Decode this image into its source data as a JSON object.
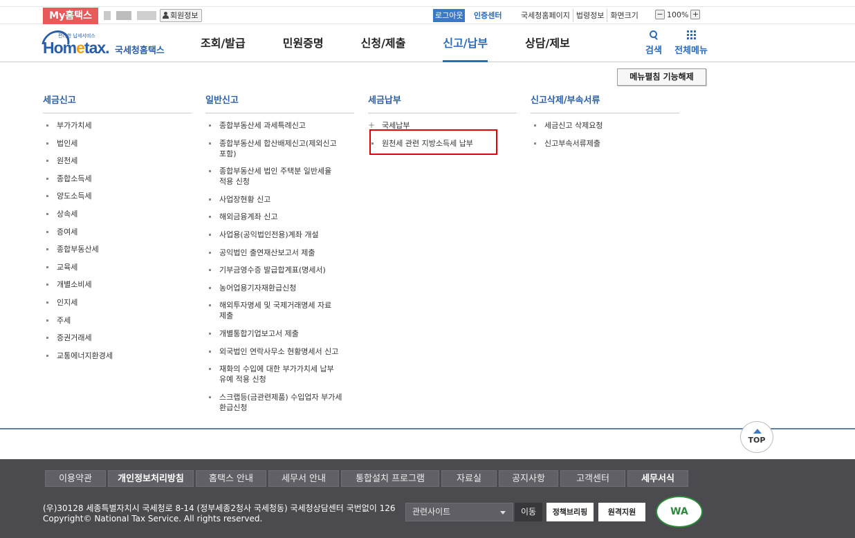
{
  "topbar": {
    "my_label": "My홈택스",
    "member_info": "회원정보",
    "logout": "로그아웃",
    "cert_center": "인증센터",
    "links": [
      "국세청홈페이지",
      "법령정보",
      "화면크기"
    ],
    "zoom_minus": "−",
    "zoom_value": "100%",
    "zoom_plus": "+"
  },
  "logo": {
    "main_a": "Hom",
    "main_e": "e",
    "main_b": "tax.",
    "sub": "국세청홈택스",
    "tiny": "편리한 납세서비스"
  },
  "gnb": [
    {
      "label": "조회/발급"
    },
    {
      "label": "민원증명"
    },
    {
      "label": "신청/제출"
    },
    {
      "label": "신고/납부",
      "active": true
    },
    {
      "label": "상담/제보"
    }
  ],
  "header_tools": {
    "search": "검색",
    "allmenu": "전체메뉴"
  },
  "menufix": "메뉴펼침 기능해제",
  "columns": [
    {
      "title": "세금신고",
      "items": [
        "부가가치세",
        "법인세",
        "원천세",
        "종합소득세",
        "양도소득세",
        "상속세",
        "증여세",
        "종합부동산세",
        "교육세",
        "개별소비세",
        "인지세",
        "주세",
        "증권거래세",
        "교통에너지환경세"
      ]
    },
    {
      "title": "일반신고",
      "items": [
        "종합부동산세 과세특례신고",
        "종합부동산세 합산배제신고(제외신고\n포함)",
        "종합부동산세 법인 주택분 일반세율\n적용 신청",
        "사업장현황 신고",
        "해외금융계좌 신고",
        "사업용(공익법인전용)계좌 개설",
        "공익법인 출연재산보고서 제출",
        "기부금영수증 발급합계표(명세서)",
        "농어업용기자재환급신청",
        "해외투자명세 및 국제거래명세 자료\n제출",
        "개별통합기업보고서 제출",
        "외국법인 연락사무소 현황명세서 신고",
        "재화의 수입에 대한 부가가치세 납부\n유예 적용 신청",
        "스크랩등(금관련제품) 수입업자 부가세\n환급신청"
      ]
    },
    {
      "title": "세금납부",
      "items": [
        "국세납부",
        "원천세 관련 지방소득세 납부"
      ]
    },
    {
      "title": "신고삭제/부속서류",
      "items": [
        "세금신고 삭제요청",
        "신고부속서류제출"
      ]
    }
  ],
  "top_button": "TOP",
  "footer": {
    "nav": [
      "이용약관",
      "개인정보처리방침",
      "홈택스 안내",
      "세무서 안내",
      "통합설치 프로그램",
      "자료실",
      "공지사항",
      "고객센터",
      "세무서식"
    ],
    "address": "(우)30128 세종특별자치시 국세청로 8-14 (정부세종2청사 국세청동) 국세청상담센터 국번없이 126",
    "copyright": "Copyright© National Tax Service. All rights reserved.",
    "related_sites": "관련사이트",
    "go": "이동",
    "badge1": "정책브리핑",
    "badge2": "원격지원",
    "wa": "WA"
  }
}
